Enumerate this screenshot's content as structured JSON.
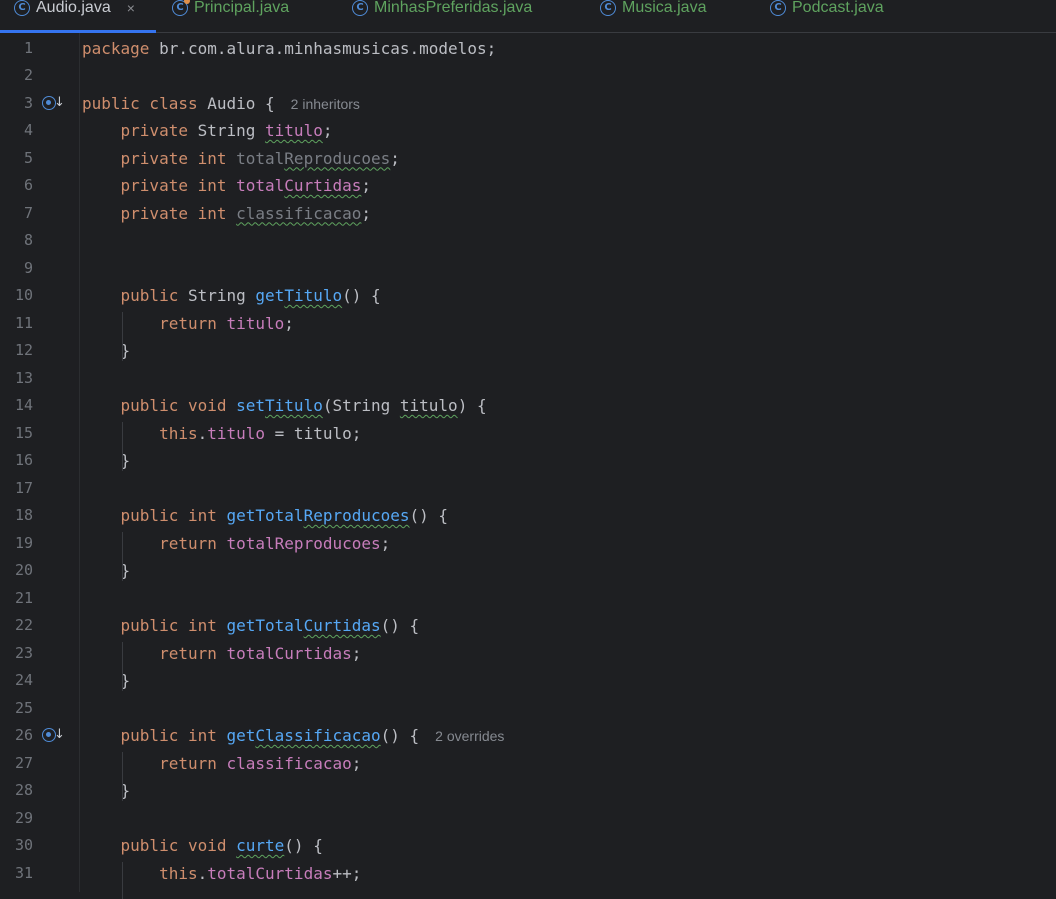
{
  "tabs": [
    {
      "label": "Audio.java",
      "active": true,
      "close": "×",
      "icon": "class-icon"
    },
    {
      "label": "Principal.java",
      "active": false,
      "icon": "class-main-icon"
    },
    {
      "label": "MinhasPreferidas.java",
      "active": false,
      "icon": "class-icon"
    },
    {
      "label": "Musica.java",
      "active": false,
      "icon": "class-icon"
    },
    {
      "label": "Podcast.java",
      "active": false,
      "icon": "class-icon"
    }
  ],
  "icon_glyph": "C",
  "gutter_arrow": "↓",
  "lines": [
    {
      "n": "1",
      "tokens": [
        {
          "t": "package ",
          "c": "kw"
        },
        {
          "t": "br.com.alura.minhasmusicas.modelos;",
          "c": "plain"
        }
      ]
    },
    {
      "n": "2",
      "tokens": []
    },
    {
      "n": "3",
      "gutter": true,
      "tokens": [
        {
          "t": "public class ",
          "c": "kw"
        },
        {
          "t": "Audio {",
          "c": "plain"
        }
      ],
      "hint": "2 inheritors"
    },
    {
      "n": "4",
      "tokens": [
        {
          "t": "    private ",
          "c": "kw"
        },
        {
          "t": "String ",
          "c": "plain"
        },
        {
          "t": "titulo",
          "c": "field squig"
        },
        {
          "t": ";",
          "c": "plain"
        }
      ]
    },
    {
      "n": "5",
      "tokens": [
        {
          "t": "    private int ",
          "c": "kw"
        },
        {
          "t": "total",
          "c": "muted"
        },
        {
          "t": "Reproducoes",
          "c": "muted squig"
        },
        {
          "t": ";",
          "c": "plain"
        }
      ]
    },
    {
      "n": "6",
      "tokens": [
        {
          "t": "    private int ",
          "c": "kw"
        },
        {
          "t": "total",
          "c": "field"
        },
        {
          "t": "Curtidas",
          "c": "field squig"
        },
        {
          "t": ";",
          "c": "plain"
        }
      ]
    },
    {
      "n": "7",
      "tokens": [
        {
          "t": "    private int ",
          "c": "kw"
        },
        {
          "t": "classificacao",
          "c": "muted squig"
        },
        {
          "t": ";",
          "c": "plain"
        }
      ]
    },
    {
      "n": "8",
      "tokens": []
    },
    {
      "n": "9",
      "tokens": []
    },
    {
      "n": "10",
      "tokens": [
        {
          "t": "    public ",
          "c": "kw"
        },
        {
          "t": "String ",
          "c": "plain"
        },
        {
          "t": "get",
          "c": "fn"
        },
        {
          "t": "Titulo",
          "c": "fn squig"
        },
        {
          "t": "() {",
          "c": "plain"
        }
      ]
    },
    {
      "n": "11",
      "tokens": [
        {
          "t": "        return ",
          "c": "kw"
        },
        {
          "t": "titulo",
          "c": "field"
        },
        {
          "t": ";",
          "c": "plain"
        }
      ]
    },
    {
      "n": "12",
      "tokens": [
        {
          "t": "    }",
          "c": "plain"
        }
      ]
    },
    {
      "n": "13",
      "tokens": []
    },
    {
      "n": "14",
      "tokens": [
        {
          "t": "    public void ",
          "c": "kw"
        },
        {
          "t": "set",
          "c": "fn"
        },
        {
          "t": "Titulo",
          "c": "fn squig"
        },
        {
          "t": "(String ",
          "c": "plain"
        },
        {
          "t": "titulo",
          "c": "plain squig"
        },
        {
          "t": ") {",
          "c": "plain"
        }
      ]
    },
    {
      "n": "15",
      "tokens": [
        {
          "t": "        this",
          "c": "kw"
        },
        {
          "t": ".",
          "c": "plain"
        },
        {
          "t": "titulo",
          "c": "field"
        },
        {
          "t": " = titulo;",
          "c": "plain"
        }
      ]
    },
    {
      "n": "16",
      "tokens": [
        {
          "t": "    }",
          "c": "plain"
        }
      ]
    },
    {
      "n": "17",
      "tokens": []
    },
    {
      "n": "18",
      "tokens": [
        {
          "t": "    public int ",
          "c": "kw"
        },
        {
          "t": "getTotal",
          "c": "fn"
        },
        {
          "t": "Reproducoes",
          "c": "fn squig"
        },
        {
          "t": "() {",
          "c": "plain"
        }
      ]
    },
    {
      "n": "19",
      "tokens": [
        {
          "t": "        return ",
          "c": "kw"
        },
        {
          "t": "totalReproducoes",
          "c": "field"
        },
        {
          "t": ";",
          "c": "plain"
        }
      ]
    },
    {
      "n": "20",
      "tokens": [
        {
          "t": "    }",
          "c": "plain"
        }
      ]
    },
    {
      "n": "21",
      "tokens": []
    },
    {
      "n": "22",
      "tokens": [
        {
          "t": "    public int ",
          "c": "kw"
        },
        {
          "t": "getTotal",
          "c": "fn"
        },
        {
          "t": "Curtidas",
          "c": "fn squig"
        },
        {
          "t": "() {",
          "c": "plain"
        }
      ]
    },
    {
      "n": "23",
      "tokens": [
        {
          "t": "        return ",
          "c": "kw"
        },
        {
          "t": "totalCurtidas",
          "c": "field"
        },
        {
          "t": ";",
          "c": "plain"
        }
      ]
    },
    {
      "n": "24",
      "tokens": [
        {
          "t": "    }",
          "c": "plain"
        }
      ]
    },
    {
      "n": "25",
      "tokens": []
    },
    {
      "n": "26",
      "gutter": true,
      "tokens": [
        {
          "t": "    public int ",
          "c": "kw"
        },
        {
          "t": "get",
          "c": "fn"
        },
        {
          "t": "Classificacao",
          "c": "fn squig"
        },
        {
          "t": "() {",
          "c": "plain"
        }
      ],
      "hint": "2 overrides"
    },
    {
      "n": "27",
      "tokens": [
        {
          "t": "        return ",
          "c": "kw"
        },
        {
          "t": "classificacao",
          "c": "field"
        },
        {
          "t": ";",
          "c": "plain"
        }
      ]
    },
    {
      "n": "28",
      "tokens": [
        {
          "t": "    }",
          "c": "plain"
        }
      ]
    },
    {
      "n": "29",
      "tokens": []
    },
    {
      "n": "30",
      "tokens": [
        {
          "t": "    public void ",
          "c": "kw"
        },
        {
          "t": "curte",
          "c": "fn squig"
        },
        {
          "t": "() {",
          "c": "plain"
        }
      ]
    },
    {
      "n": "31",
      "tokens": [
        {
          "t": "        this",
          "c": "kw"
        },
        {
          "t": ".",
          "c": "plain"
        },
        {
          "t": "totalCurtidas",
          "c": "field"
        },
        {
          "t": "++;",
          "c": "plain"
        }
      ]
    }
  ],
  "colors": {
    "background": "#1e1f22",
    "keyword": "#cf8e6d",
    "field": "#c77dbb",
    "method": "#56a8f5",
    "text": "#bcbec4",
    "line_number": "#6f737a",
    "active_tab_underline": "#3574f0",
    "tab_inactive_text": "#5fa35f"
  }
}
